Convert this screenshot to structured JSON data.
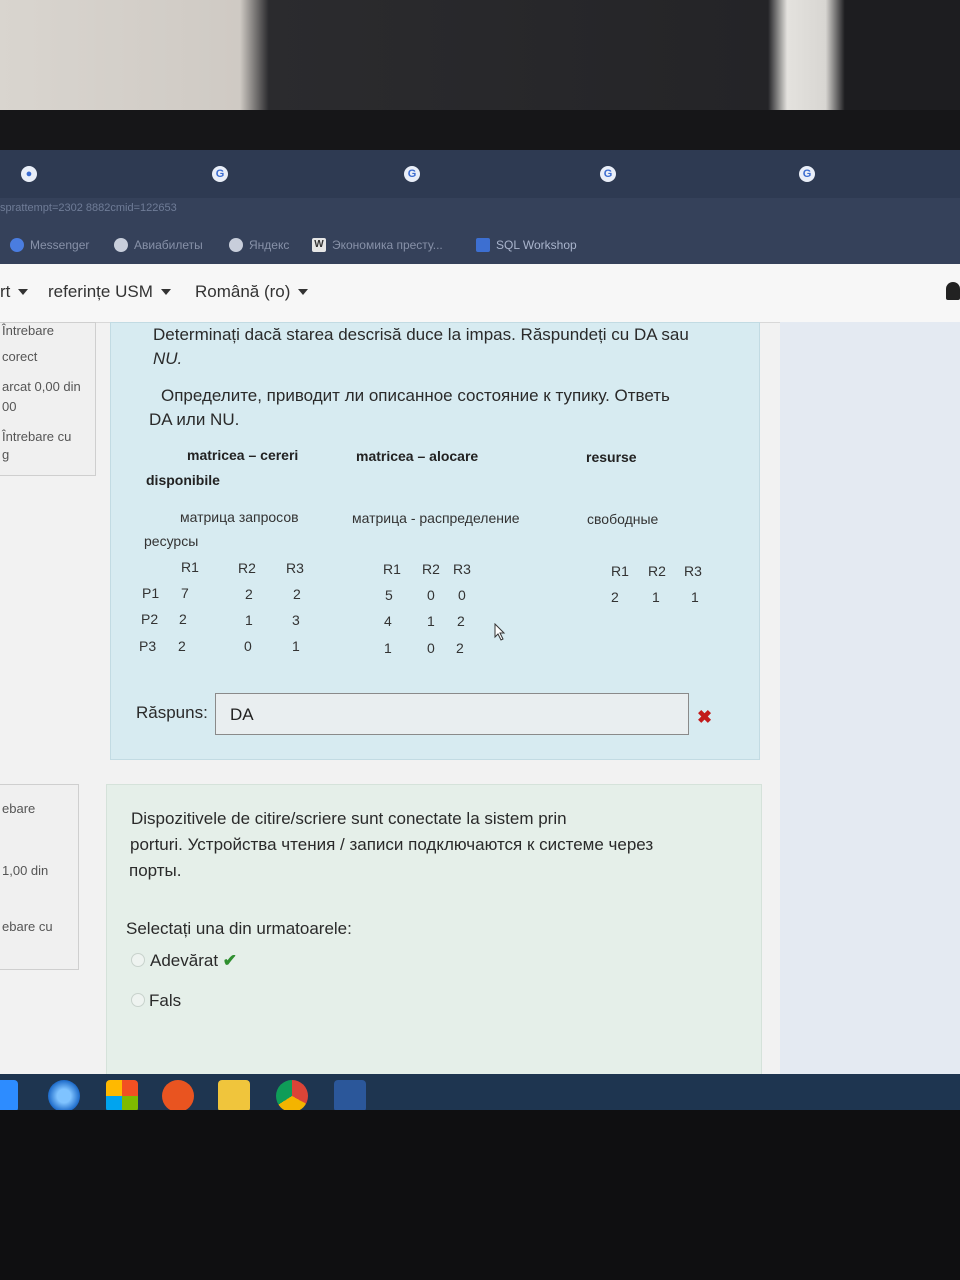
{
  "browser": {
    "tab_icons": [
      "globe-icon",
      "google-icon",
      "google-icon",
      "google-icon",
      "google-icon"
    ],
    "url": "sprattempt=2302 8882cmid=122653",
    "bookmarks": [
      {
        "label": "Messenger",
        "icon": "messenger-icon"
      },
      {
        "label": "Авиабилеты",
        "icon": "globe-icon"
      },
      {
        "label": "Яндекс",
        "icon": "globe-icon"
      },
      {
        "label": "Экономика престу...",
        "icon": "word-icon"
      },
      {
        "label": "SQL Workshop",
        "icon": "sql-icon"
      }
    ]
  },
  "nav": {
    "item1": "rt",
    "item2": "referințe USM",
    "item3": "Română (ro)"
  },
  "question_info_1": {
    "line1": "Întrebare",
    "line2": "corect",
    "line3": "arcat 0,00 din",
    "line4": "00",
    "line5": "Întrebare cu",
    "line6": "g"
  },
  "question_info_2": {
    "line1": "ebare",
    "line2": "1,00 din",
    "line3": "ebare cu"
  },
  "question1": {
    "text_ro_1": "Determinați dacă starea descrisă duce la impas. Răspundeți cu DA sau",
    "text_ro_2": "NU.",
    "text_ru_1": "Определите, приводит ли описанное состояние к тупику. Ответь",
    "text_ru_2": "DA или NU.",
    "header_cereri": "matricea – cereri",
    "header_alocare": "matricea – alocare",
    "header_resurse": "resurse",
    "header_disponibile": "disponibile",
    "sub_zaprosov": "матрица запросов",
    "sub_raspredelenie": "матрица - распределение",
    "sub_svobodnye": "свободные",
    "sub_resursy": "ресурсы",
    "columns": [
      "R1",
      "R2",
      "R3"
    ],
    "rows": [
      "P1",
      "P2",
      "P3"
    ],
    "cereri": [
      [
        "7",
        "2",
        "2"
      ],
      [
        "2",
        "1",
        "3"
      ],
      [
        "2",
        "0",
        "1"
      ]
    ],
    "alocare": [
      [
        "5",
        "0",
        "0"
      ],
      [
        "4",
        "1",
        "2"
      ],
      [
        "1",
        "0",
        "2"
      ]
    ],
    "disponibile": [
      "2",
      "1",
      "1"
    ],
    "answer_label": "Răspuns:",
    "answer_value": "DA"
  },
  "question2": {
    "text_1": "Dispozitivele de citire/scriere sunt conectate la sistem prin",
    "text_2": "porturi.  Устройства чтения / записи подключаются к системе через",
    "text_3": "порты.",
    "prompt": "Selectați una din urmatoarele:",
    "option1": "Adevărat",
    "option2": "Fals"
  },
  "colors": {
    "question_bg": "#d7ebf1",
    "wrong": "#c21b1b",
    "correct": "#2f8f2f",
    "taskbar": "#1e3550"
  }
}
